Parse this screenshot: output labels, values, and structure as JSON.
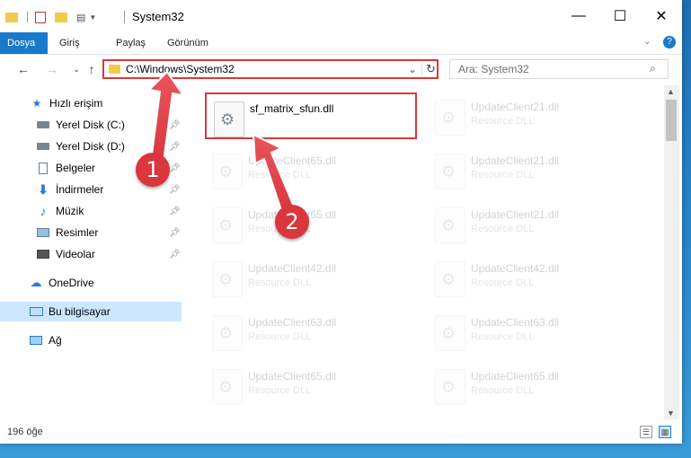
{
  "window": {
    "title": "System32"
  },
  "window_controls": {
    "minimize": "—",
    "maximize": "☐",
    "close": "✕"
  },
  "ribbon": {
    "tabs": [
      {
        "label": "Dosya"
      },
      {
        "label": "Giriş"
      },
      {
        "label": "Paylaş"
      },
      {
        "label": "Görünüm"
      }
    ]
  },
  "address_bar": {
    "path": "C:\\Windows\\System32"
  },
  "search": {
    "placeholder": "Ara: System32"
  },
  "sidebar": {
    "items": [
      {
        "label": "Hızlı erişim",
        "icon": "star-icon"
      },
      {
        "label": "Yerel Disk (C:)",
        "icon": "drive-icon",
        "pinned": true
      },
      {
        "label": "Yerel Disk (D:)",
        "icon": "drive-icon",
        "pinned": true
      },
      {
        "label": "Belgeler",
        "icon": "document-icon",
        "pinned": true
      },
      {
        "label": "İndirmeler",
        "icon": "download-icon",
        "pinned": true
      },
      {
        "label": "Müzik",
        "icon": "music-icon",
        "pinned": true
      },
      {
        "label": "Resimler",
        "icon": "picture-icon",
        "pinned": true
      },
      {
        "label": "Videolar",
        "icon": "video-icon",
        "pinned": true
      },
      {
        "label": "OneDrive",
        "icon": "cloud-icon"
      },
      {
        "label": "Bu bilgisayar",
        "icon": "computer-icon",
        "selected": true
      },
      {
        "label": "Ağ",
        "icon": "network-icon"
      }
    ]
  },
  "files": [
    {
      "name": "sf_matrix_sfun.dll",
      "type": "",
      "highlighted": true
    },
    {
      "name": "UpdateClient21.dll",
      "type": "Resource DLL"
    },
    {
      "name": "UpdateClient65.dll",
      "type": "Resource DLL"
    },
    {
      "name": "UpdateClient21.dll",
      "type": "Resource DLL"
    },
    {
      "name": "UpdateClient65.dll",
      "type": "Resource DLL"
    },
    {
      "name": "UpdateClient21.dll",
      "type": "Resource DLL"
    },
    {
      "name": "UpdateClient42.dll",
      "type": "Resource DLL"
    },
    {
      "name": "UpdateClient42.dll",
      "type": "Resource DLL"
    },
    {
      "name": "UpdateClient63.dll",
      "type": "Resource DLL"
    },
    {
      "name": "UpdateClient63.dll",
      "type": "Resource DLL"
    },
    {
      "name": "UpdateClient65.dll",
      "type": "Resource DLL"
    },
    {
      "name": "UpdateClient65.dll",
      "type": "Resource DLL"
    }
  ],
  "status": {
    "item_count": "196 öğe"
  },
  "callouts": {
    "step1": "1",
    "step2": "2"
  },
  "colors": {
    "accent": "#1979ca",
    "highlight": "#d63a3a",
    "selection": "#cce8ff"
  }
}
